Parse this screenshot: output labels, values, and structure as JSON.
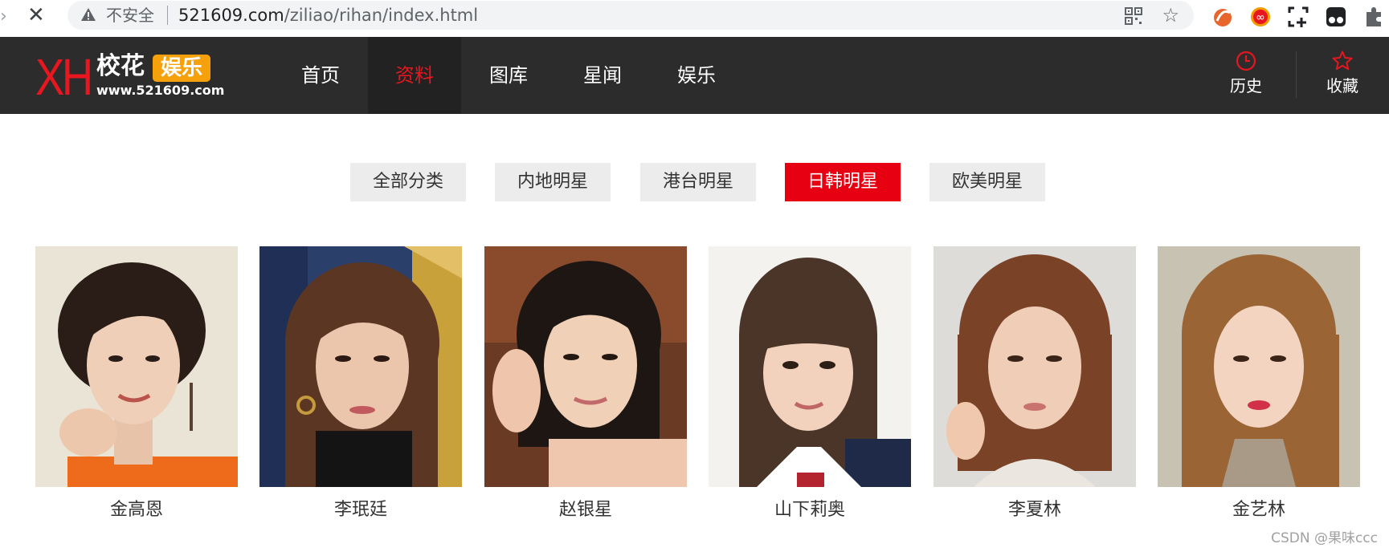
{
  "browser": {
    "security_label": "不安全",
    "url_host": "521609.com",
    "url_path": "/ziliao/rihan/index.html"
  },
  "site": {
    "logo_letters": "XH",
    "logo_name": "校花",
    "logo_tag": "娱乐",
    "logo_domain": "www.521609.com",
    "nav": [
      {
        "label": "首页",
        "active": false
      },
      {
        "label": "资料",
        "active": true
      },
      {
        "label": "图库",
        "active": false
      },
      {
        "label": "星闻",
        "active": false
      },
      {
        "label": "娱乐",
        "active": false
      }
    ],
    "history_label": "历史",
    "favorites_label": "收藏"
  },
  "filters": [
    {
      "label": "全部分类",
      "active": false
    },
    {
      "label": "内地明星",
      "active": false
    },
    {
      "label": "港台明星",
      "active": false
    },
    {
      "label": "日韩明星",
      "active": true
    },
    {
      "label": "欧美明星",
      "active": false
    }
  ],
  "stars": [
    {
      "name": "金高恩"
    },
    {
      "name": "李珉廷"
    },
    {
      "name": "赵银星"
    },
    {
      "name": "山下莉奥"
    },
    {
      "name": "李夏林"
    },
    {
      "name": "金艺林"
    }
  ],
  "watermark": "CSDN @果味ccc",
  "colors": {
    "header_bg": "#2c2c2c",
    "accent_red": "#e60012",
    "logo_orange": "#f6a10b",
    "filter_bg": "#ececec"
  },
  "icons": {
    "history": "clock-icon",
    "favorites": "star-outline-icon",
    "security": "warning-triangle-icon",
    "bookmark": "star-icon"
  }
}
